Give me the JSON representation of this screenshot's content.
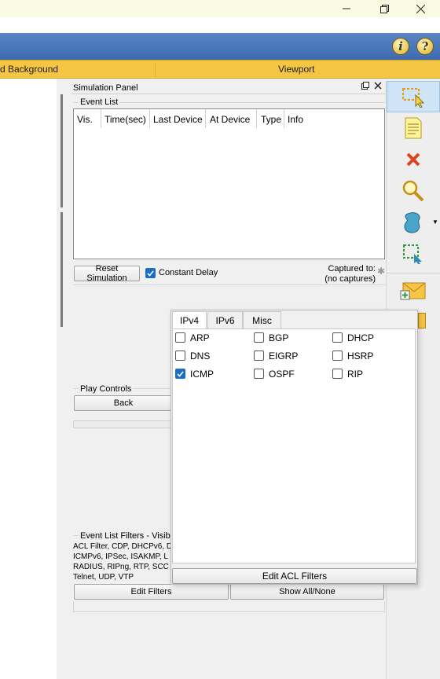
{
  "window": {
    "controls": [
      "minimize-icon",
      "restore-icon",
      "close-icon"
    ]
  },
  "toolbar": {
    "info_icon": "i",
    "help_icon": "?"
  },
  "tabs": {
    "left_label": "d Background",
    "right_label": "Viewport"
  },
  "simulation_panel": {
    "title": "Simulation Panel",
    "event_list": {
      "label": "Event List",
      "columns": [
        "Vis.",
        "Time(sec)",
        "Last Device",
        "At Device",
        "Type",
        "Info"
      ]
    },
    "reset_button": "Reset Simulation",
    "constant_delay": {
      "label": "Constant Delay",
      "checked": true
    },
    "captured": {
      "line1": "Captured to:",
      "line2": "(no captures)"
    },
    "play_controls": {
      "label": "Play Controls",
      "back_button": "Back"
    },
    "filters": {
      "label": "Event List Filters - Visible",
      "lines": [
        "ACL Filter, CDP, DHCPv6, D",
        "ICMPv6, IPSec, ISAKMP, L",
        "RADIUS, RIPng, RTP, SCC",
        "Telnet, UDP, VTP"
      ],
      "edit_button": "Edit Filters",
      "show_all_button": "Show All/None"
    }
  },
  "popup": {
    "tabs": [
      "IPv4",
      "IPv6",
      "Misc"
    ],
    "active_tab": "IPv4",
    "protocols": [
      {
        "label": "ARP",
        "checked": false
      },
      {
        "label": "BGP",
        "checked": false
      },
      {
        "label": "DHCP",
        "checked": false
      },
      {
        "label": "DNS",
        "checked": false
      },
      {
        "label": "EIGRP",
        "checked": false
      },
      {
        "label": "HSRP",
        "checked": false
      },
      {
        "label": "ICMP",
        "checked": true
      },
      {
        "label": "OSPF",
        "checked": false
      },
      {
        "label": "RIP",
        "checked": false
      }
    ],
    "edit_acl_button": "Edit ACL Filters"
  },
  "tools": [
    "select-icon",
    "note-icon",
    "delete-icon",
    "inspect-icon",
    "draw-shape-icon",
    "resize-icon",
    "add-pdu-icon",
    "add-complex-pdu-icon"
  ],
  "colors": {
    "toolbar_blue": "#4a78bb",
    "tab_yellow": "#f5c644",
    "check_blue": "#1a6fc4"
  }
}
